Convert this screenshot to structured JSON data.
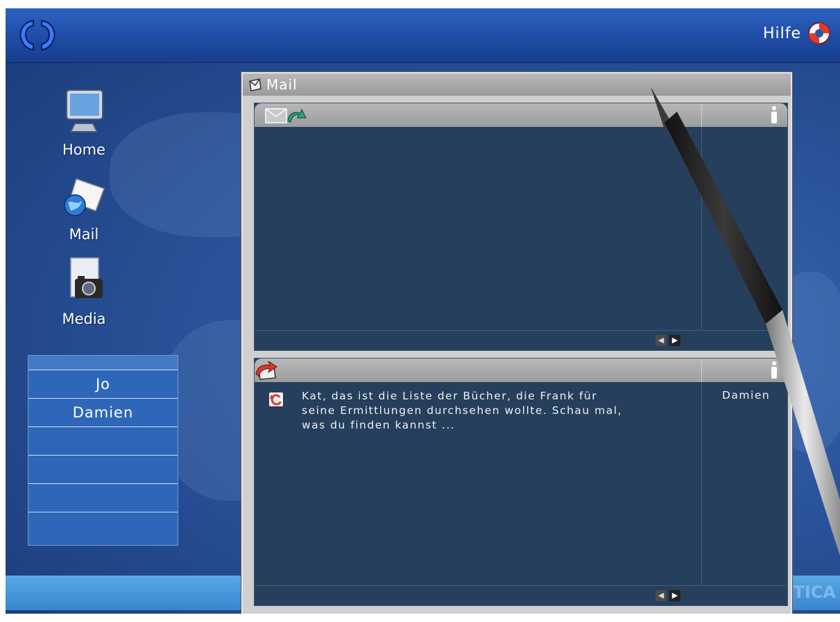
{
  "header": {
    "help_label": "Hilfe"
  },
  "nav": [
    {
      "label": "Home"
    },
    {
      "label": "Mail"
    },
    {
      "label": "Media"
    }
  ],
  "contacts": [
    "Jo",
    "Damien",
    "",
    "",
    "",
    ""
  ],
  "mail_window": {
    "title": "Mail",
    "inbox": {
      "messages": []
    },
    "sent": {
      "messages": [
        {
          "text": "Kat, das ist die Liste der Bücher, die Frank für seine Ermittlungen durchsehen wollte. Schau mal, was du finden kannst ...",
          "sender": "Damien"
        }
      ]
    }
  },
  "footer": {
    "brand": "TICA"
  },
  "colors": {
    "accent": "#2b559c",
    "panel": "#253f5c"
  }
}
